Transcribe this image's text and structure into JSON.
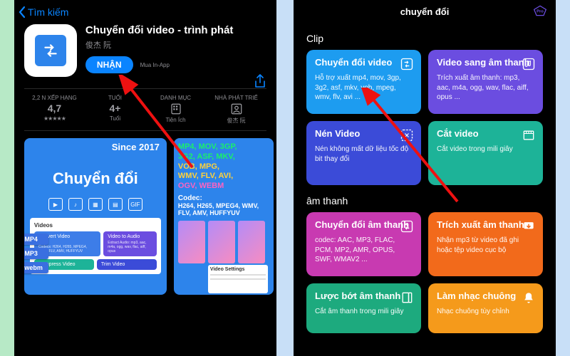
{
  "left": {
    "back": "Tìm kiếm",
    "title": "Chuyển đổi video - trình phát",
    "developer": "俊杰 阮",
    "get": "NHẬN",
    "iap": "Mua In-App",
    "info": {
      "ratingLabel": "2,2 N XẾP HẠNG",
      "ratingValue": "4,7",
      "ageLabel": "TUỔI",
      "ageValue": "4+",
      "ageSub": "Tuổi",
      "categoryLabel": "DANH MỤC",
      "categorySub": "Tiện Ích",
      "devLabel": "NHÀ PHÁT TRIỂ",
      "devSub": "俊杰 阮"
    },
    "ss1": {
      "since": "Since 2017",
      "bigTitle": "Chuyển đổi",
      "gif": "GIF",
      "panelTitle": "Videos",
      "chips": [
        "Convert Video",
        "Video to Audio",
        "Compress Video",
        "Trim Video"
      ],
      "chipSub": "Codecs: H264, H265, MPEG4, WMV, FLV, AMV, HUFFYUV",
      "chipSub2": "Extract Audio: mp3, aac, m4a, ogg, wav, flac, aiff, opus",
      "tags": [
        ".MP4",
        ".MP3",
        ".webm"
      ]
    },
    "ss2": {
      "fmt1": "MP4, MOV, 3GP,",
      "fmt2": "3G2, ASF, MKV,",
      "fmt3": "VOB, MPG,",
      "fmt4": "WMV, FLV, AVI,",
      "fmt5": "OGV, WEBM",
      "codecLabel": "Codec:",
      "codec": "H264, H265, MPEG4, WMV, FLV, AMV, HUFFYUV",
      "vs": "Video Settings"
    }
  },
  "right": {
    "title": "chuyển đổi",
    "section1": "Clip",
    "section2": "âm thanh",
    "cards": {
      "convert": {
        "title": "Chuyển đổi video",
        "sub": "Hỗ trợ xuất mp4, mov, 3gp, 3g2, asf, mkv, vob, mpeg, wmv, flv, avi ..."
      },
      "toAudio": {
        "title": "Video sang âm thanh",
        "sub": "Trích xuất âm thanh: mp3, aac, m4a, ogg, wav, flac, aiff, opus ..."
      },
      "compress": {
        "title": "Nén Video",
        "sub": "Nén không mất dữ liệu tốc độ bit thay đổi"
      },
      "cut": {
        "title": "Cắt video",
        "sub": "Cắt video trong mili giây"
      },
      "convAudio": {
        "title": "Chuyển đổi âm thanh",
        "sub": "codec: AAC, MP3, FLAC, PCM, MP2, AMR, OPUS, SWF, WMAV2 ..."
      },
      "extract": {
        "title": "Trích xuất âm thanh",
        "sub": "Nhận mp3 từ video đã ghi hoặc tệp video cục bộ"
      },
      "trimAudio": {
        "title": "Lược bớt âm thanh",
        "sub": "Cắt âm thanh trong mili giây"
      },
      "ringtone": {
        "title": "Làm nhạc chuông",
        "sub": "Nhạc chuông tùy chỉnh"
      }
    }
  }
}
